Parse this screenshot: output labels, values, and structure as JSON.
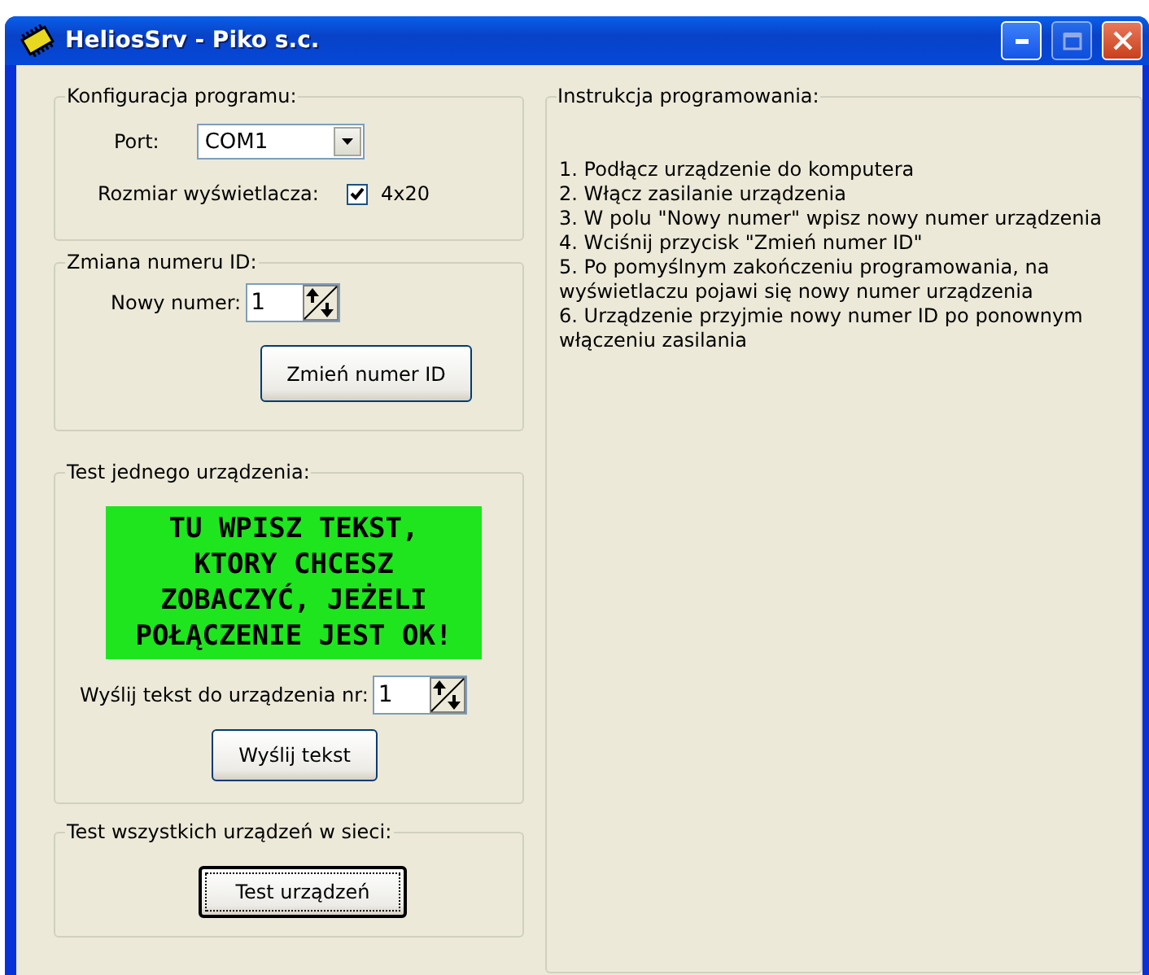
{
  "window": {
    "title": "HeliosSrv - Piko s.c."
  },
  "config": {
    "title": "Konfiguracja programu:",
    "port_label": "Port:",
    "port_value": "COM1",
    "display_label": "Rozmiar wyświetlacza:",
    "display_checkbox": {
      "label": "4x20",
      "checked": true
    }
  },
  "change_id": {
    "title": "Zmiana numeru ID:",
    "label": "Nowy numer:",
    "value": "1",
    "button": "Zmień numer ID"
  },
  "single_test": {
    "title": "Test jednego urządzenia:",
    "lcd_lines": [
      "TU WPISZ TEKST,",
      "KTORY CHCESZ",
      "ZOBACZYĆ, JEŻELI",
      "POŁĄCZENIE JEST OK!"
    ],
    "label": "Wyślij tekst do urządzenia nr:",
    "value": "1",
    "button": "Wyślij tekst"
  },
  "network_test": {
    "title": "Test wszystkich urządzeń w sieci:",
    "button": {
      "label": "Test urządzeń",
      "focused": true
    }
  },
  "instructions": {
    "title": "Instrukcja programowania:",
    "steps": [
      "1. Podłącz urządzenie do komputera",
      "2. Włącz zasilanie urządzenia",
      "3. W polu \"Nowy numer\" wpisz nowy numer urządzenia",
      "4. Wciśnij przycisk \"Zmień numer ID\"",
      "5. Po pomyślnym zakończeniu programowania, na wyświetlaczu pojawi się nowy numer urządzenia",
      "6. Urządzenie przyjmie nowy numer ID po ponownym włączeniu zasilania"
    ]
  }
}
